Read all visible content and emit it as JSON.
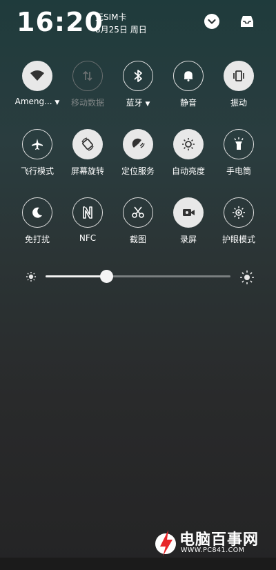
{
  "status": {
    "time": "16:20",
    "sim": "无SIM卡",
    "date": "8月25日 周日"
  },
  "tiles": [
    {
      "label": "Ameng...",
      "icon": "wifi-icon",
      "state": "on",
      "dropdown": true
    },
    {
      "label": "移动数据",
      "icon": "mobile-data-icon",
      "state": "disabled"
    },
    {
      "label": "蓝牙",
      "icon": "bluetooth-icon",
      "state": "off",
      "dropdown": true
    },
    {
      "label": "静音",
      "icon": "bell-icon",
      "state": "off"
    },
    {
      "label": "振动",
      "icon": "vibrate-icon",
      "state": "on"
    },
    {
      "label": "飞行模式",
      "icon": "airplane-icon",
      "state": "off"
    },
    {
      "label": "屏幕旋转",
      "icon": "rotate-icon",
      "state": "on"
    },
    {
      "label": "定位服务",
      "icon": "location-icon",
      "state": "on"
    },
    {
      "label": "自动亮度",
      "icon": "auto-brightness-icon",
      "state": "on"
    },
    {
      "label": "手电筒",
      "icon": "flashlight-icon",
      "state": "off"
    },
    {
      "label": "免打扰",
      "icon": "moon-icon",
      "state": "off"
    },
    {
      "label": "NFC",
      "icon": "nfc-icon",
      "state": "off"
    },
    {
      "label": "截图",
      "icon": "scissors-icon",
      "state": "off"
    },
    {
      "label": "录屏",
      "icon": "screen-record-icon",
      "state": "on"
    },
    {
      "label": "护眼模式",
      "icon": "eye-care-icon",
      "state": "off"
    }
  ],
  "brightness": {
    "level": 0.33
  },
  "watermark": {
    "text": "电脑百事网",
    "url": "WWW.PC841.COM"
  },
  "colors": {
    "tile_on": "#e8e8e8",
    "tile_off_border": "#e0e0e0",
    "disabled_text": "#7c8283"
  }
}
